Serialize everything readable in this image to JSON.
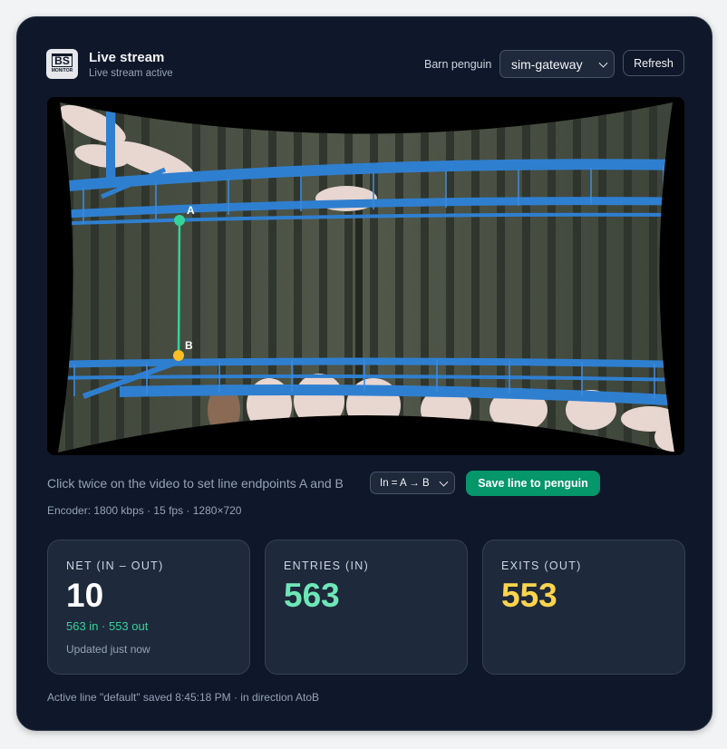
{
  "header": {
    "title": "Live stream",
    "subtitle": "Live stream active",
    "barn_label": "Barn penguin",
    "gateway_selected": "sim-gateway",
    "refresh_label": "Refresh",
    "logo_text": "BS",
    "logo_sub": "MONITOR"
  },
  "video": {
    "point_a_label": "A",
    "point_b_label": "B"
  },
  "controls": {
    "hint": "Click twice on the video to set line endpoints A and B",
    "direction_selected": "In = A → B",
    "save_label": "Save line to penguin",
    "encoder_info": "Encoder: 1800 kbps · 15 fps · 1280×720"
  },
  "stats": {
    "net": {
      "label": "NET (IN – OUT)",
      "value": "10",
      "detail": "563 in · 553 out",
      "updated": "Updated just now"
    },
    "entries": {
      "label": "ENTRIES (IN)",
      "value": "563"
    },
    "exits": {
      "label": "EXITS (OUT)",
      "value": "553"
    }
  },
  "footer": "Active line \"default\" saved 8:45:18 PM · in direction AtoB",
  "colors": {
    "card_bg": "#0f172a",
    "net_value": "#ffffff",
    "entries_value": "#6ee7b7",
    "exits_value": "#fcd34d",
    "line_color": "#34d399",
    "point_a": "#34d399",
    "point_b": "#fbbf24",
    "save_button": "#059669"
  }
}
